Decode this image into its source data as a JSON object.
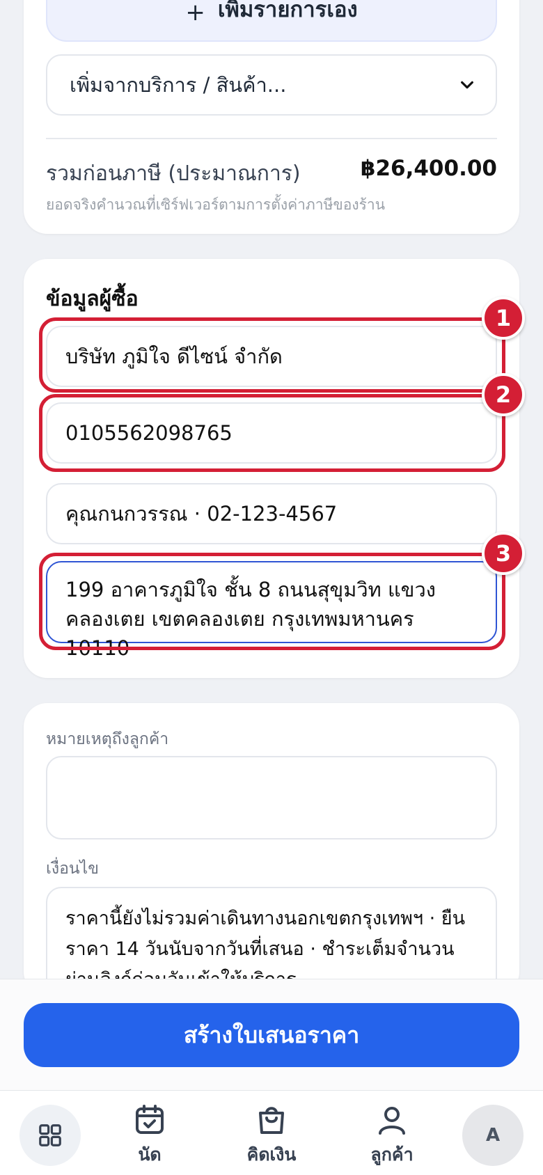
{
  "items": {
    "add_manual_icon": "+",
    "add_manual_label": "เพิ่มรายการเอง",
    "add_from_select": "เพิ่มจากบริการ / สินค้า...",
    "subtotal_label": "รวมก่อนภาษี (ประมาณการ)",
    "subtotal_value": "฿26,400.00",
    "subtotal_note": "ยอดจริงคำนวณที่เซิร์ฟเวอร์ตามการตั้งค่าภาษีของร้าน"
  },
  "buyer": {
    "title": "ข้อมูลผู้ซื้อ",
    "company": "บริษัท ภูมิใจ ดีไซน์ จำกัด",
    "tax_id": "0105562098765",
    "contact": "คุณกนกวรรณ · 02-123-4567",
    "address": "199 อาคารภูมิใจ ชั้น 8 ถนนสุขุมวิท แขวง คลองเตย เขตคลองเตย กรุงเทพมหานคร 10110"
  },
  "annotations": [
    "1",
    "2",
    "3"
  ],
  "notes": {
    "customer_note_label": "หมายเหตุถึงลูกค้า",
    "customer_note_value": "",
    "terms_label": "เงื่อนไข",
    "terms_value": "ราคานี้ยังไม่รวมค่าเดินทางนอกเขตกรุงเทพฯ · ยืนราคา 14 วันนับจากวันที่เสนอ · ชำระเต็มจำนวนผ่านลิงก์ก่อนวันเข้าให้บริการ"
  },
  "actions": {
    "create_quote": "สร้างใบเสนอราคา"
  },
  "tabbar": {
    "appointments": "นัด",
    "billing": "คิดเงิน",
    "customers": "ลูกค้า",
    "avatar_initial": "A"
  },
  "colors": {
    "primary": "#2563eb",
    "highlight": "#d41f35",
    "focus_border": "#2f55d4"
  }
}
